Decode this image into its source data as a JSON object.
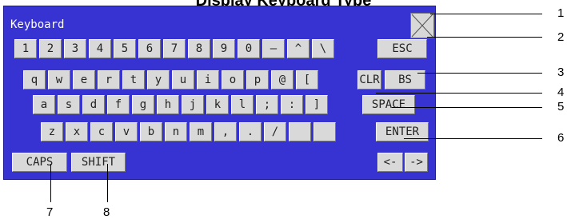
{
  "header_text": "Display Keyboard Type",
  "window": {
    "title": "Keyboard"
  },
  "rows": [
    [
      "1",
      "2",
      "3",
      "4",
      "5",
      "6",
      "7",
      "8",
      "9",
      "0",
      "—",
      "^",
      "\\",
      "ESC"
    ],
    [
      "q",
      "w",
      "e",
      "r",
      "t",
      "y",
      "u",
      "i",
      "o",
      "p",
      "@",
      "[",
      "CLR",
      "BS"
    ],
    [
      "a",
      "s",
      "d",
      "f",
      "g",
      "h",
      "j",
      "k",
      "l",
      ";",
      ":",
      "]",
      "SPACE"
    ],
    [
      "z",
      "x",
      "c",
      "v",
      "b",
      "n",
      "m",
      ",",
      ".",
      "/",
      "",
      "",
      "ENTER"
    ]
  ],
  "bottom_left": [
    "CAPS",
    "SHIFT"
  ],
  "arrows": [
    "<-",
    "->"
  ],
  "callout_numbers": [
    "1",
    "2",
    "3",
    "4",
    "5",
    "6",
    "7",
    "8"
  ]
}
